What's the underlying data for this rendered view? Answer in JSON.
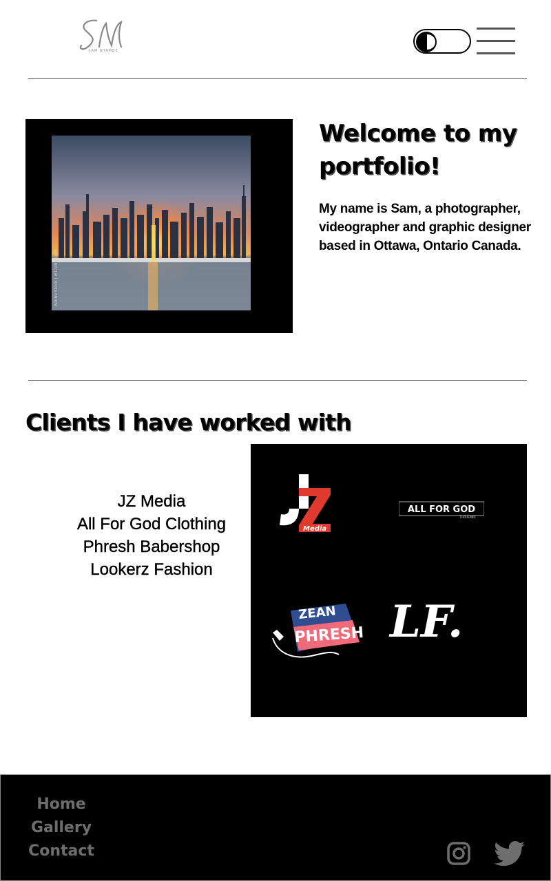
{
  "header": {
    "logo_alt": "SN",
    "logo_subtext": "SAM NTAMBE",
    "theme_toggle": "dark-mode-toggle",
    "menu_icon": "hamburger-menu-icon"
  },
  "hero": {
    "title": "Welcome to my portfolio!",
    "intro": "My name is Sam, a photographer, videographer and graphic designer based in Ottawa, Ontario Canada.",
    "photo_watermark": "Adobe Stock | #174926206"
  },
  "clients": {
    "title": "Clients I have worked with",
    "names": [
      "JZ Media",
      "All For God Clothing",
      "Phresh Babershop",
      "Lookerz Fashion"
    ],
    "logos": {
      "jz_media": "Media",
      "all_for_god": "ALL FOR GOD",
      "all_for_god_sub": "THOUSAND",
      "phresh_top": "ZEAN",
      "phresh_bottom": "PHRESH",
      "lookerz": "LF."
    }
  },
  "footer": {
    "links": [
      "Home",
      "Gallery",
      "Contact"
    ],
    "social": [
      "instagram-icon",
      "twitter-icon"
    ]
  },
  "colors": {
    "background": "#ffffff",
    "panel": "#000000",
    "footer_link": "#6e6e6e",
    "accent_red": "#e03a2f"
  }
}
